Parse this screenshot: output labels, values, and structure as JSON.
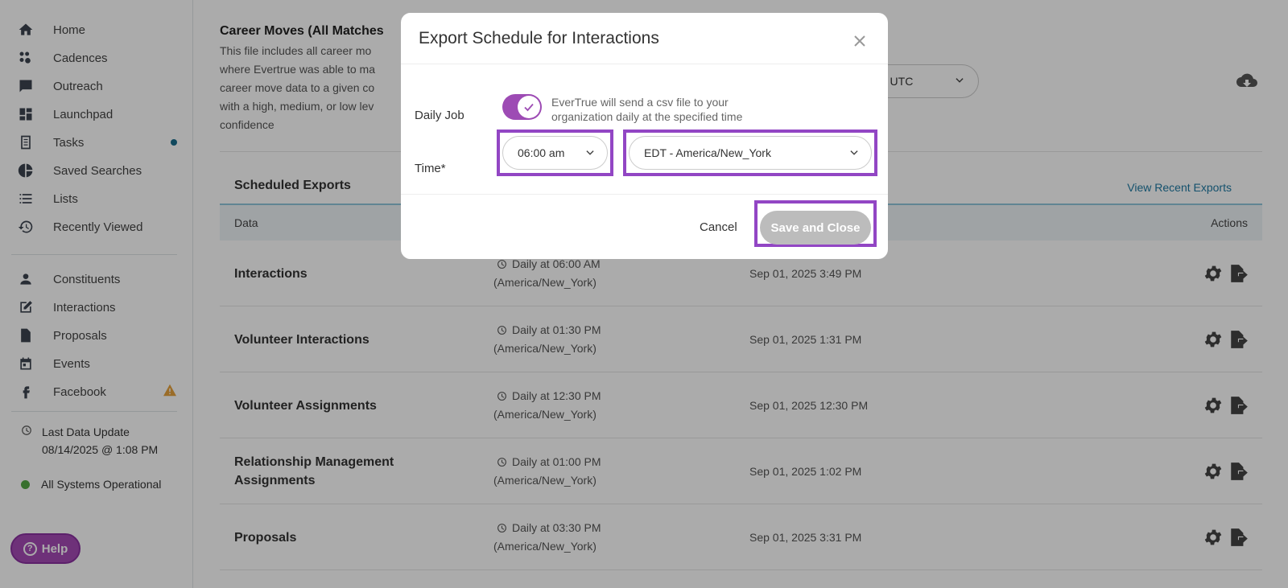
{
  "sidebar": {
    "items": [
      {
        "label": "Home",
        "icon": "home-icon"
      },
      {
        "label": "Cadences",
        "icon": "cadences-icon"
      },
      {
        "label": "Outreach",
        "icon": "chat-icon"
      },
      {
        "label": "Launchpad",
        "icon": "dashboard-icon"
      },
      {
        "label": "Tasks",
        "icon": "tasks-icon"
      },
      {
        "label": "Saved Searches",
        "icon": "pie-chart-icon"
      },
      {
        "label": "Lists",
        "icon": "list-icon"
      },
      {
        "label": "Recently Viewed",
        "icon": "history-icon"
      },
      {
        "label": "Constituents",
        "icon": "person-icon"
      },
      {
        "label": "Interactions",
        "icon": "edit-icon"
      },
      {
        "label": "Proposals",
        "icon": "document-icon"
      },
      {
        "label": "Events",
        "icon": "calendar-icon"
      },
      {
        "label": "Facebook",
        "icon": "facebook-icon"
      }
    ],
    "last_update_label": "Last Data Update",
    "last_update_value": "08/14/2025 @ 1:08 PM",
    "status": "All Systems Operational",
    "help": "Help"
  },
  "main": {
    "career_title": "Career Moves (All Matches",
    "career_desc": "This file includes all career mo where Evertrue was able to ma career move data to a given co with a high, medium, or low lev confidence",
    "bg_select": "M UTC",
    "scheduled_title": "Scheduled Exports",
    "view_recent": "View Recent Exports",
    "col_data": "Data",
    "col_actions": "Actions",
    "rows": [
      {
        "name": "Interactions",
        "sched1": "Daily at 06:00 AM",
        "sched2": "(America/New_York)",
        "when": "Sep 01, 2025 3:49 PM"
      },
      {
        "name": "Volunteer Interactions",
        "sched1": "Daily at 01:30 PM",
        "sched2": "(America/New_York)",
        "when": "Sep 01, 2025 1:31 PM"
      },
      {
        "name": "Volunteer Assignments",
        "sched1": "Daily at 12:30 PM",
        "sched2": "(America/New_York)",
        "when": "Sep 01, 2025 12:30 PM"
      },
      {
        "name": "Relationship Management Assignments",
        "sched1": "Daily at 01:00 PM",
        "sched2": "(America/New_York)",
        "when": "Sep 01, 2025 1:02 PM"
      },
      {
        "name": "Proposals",
        "sched1": "Daily at 03:30 PM",
        "sched2": "(America/New_York)",
        "when": "Sep 01, 2025 3:31 PM"
      }
    ]
  },
  "modal": {
    "title": "Export Schedule for Interactions",
    "daily_job_label": "Daily Job",
    "daily_job_desc": "EverTrue will send a csv file to your organization daily at the specified time",
    "time_label": "Time*",
    "time_value": "06:00 am",
    "timezone_value": "EDT - America/New_York",
    "cancel": "Cancel",
    "save": "Save and Close"
  },
  "colors": {
    "accent": "#9d4bb4",
    "highlight": "#9246c4",
    "link": "#1f7aa3"
  }
}
